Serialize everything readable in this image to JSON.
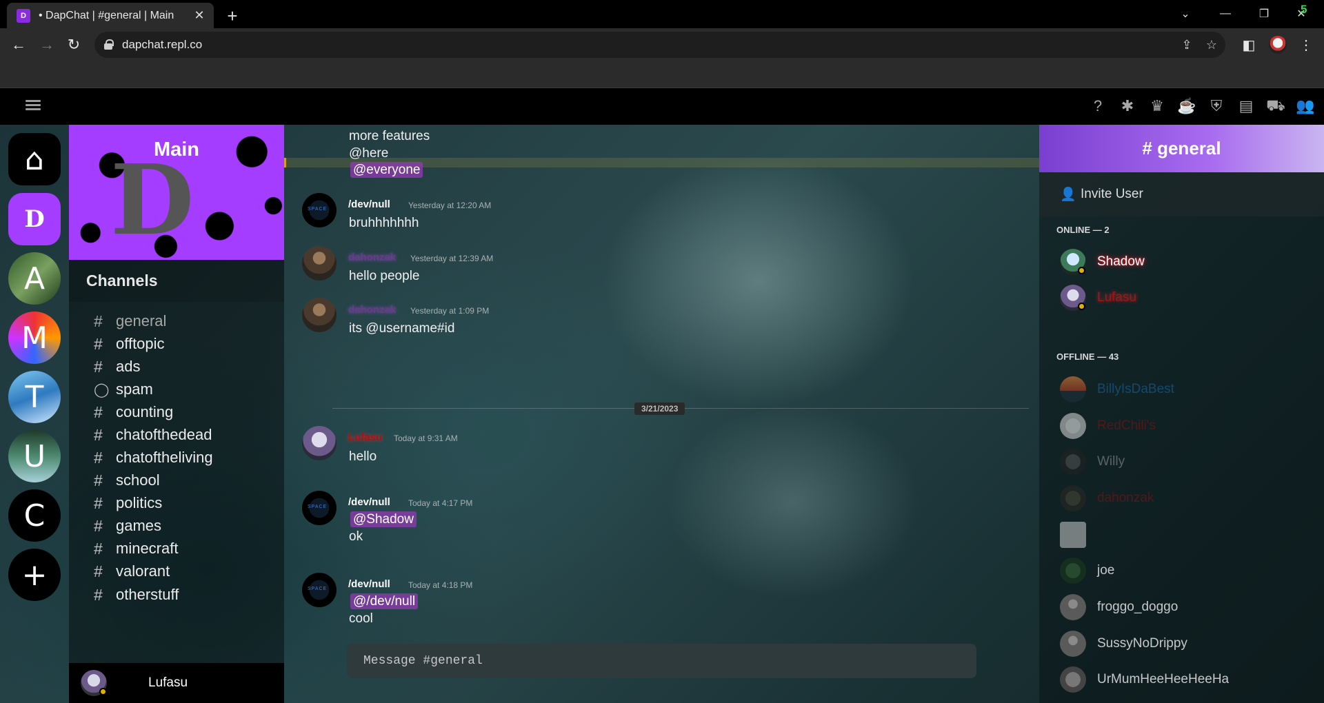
{
  "browser": {
    "tab_title": "• DapChat | #general | Main",
    "favicon": "D",
    "url": "dapchat.repl.co",
    "badge": "5"
  },
  "topnav": {
    "icons": [
      "help-icon",
      "bug-icon",
      "trophy-icon",
      "coffee-icon",
      "shield-icon",
      "briefcase-icon",
      "cart-icon",
      "friends-icon"
    ]
  },
  "servers": [
    {
      "label": "",
      "icon": "home-icon"
    },
    {
      "label": "",
      "icon": "dapchat-logo"
    },
    {
      "label": "A"
    },
    {
      "label": "M"
    },
    {
      "label": "T"
    },
    {
      "label": "U"
    },
    {
      "label": "C"
    },
    {
      "label": "+",
      "icon": "add-server-icon"
    }
  ],
  "server": {
    "banner_title": "Main",
    "banner_logo": "D"
  },
  "channels_header": "Channels",
  "channels": [
    {
      "name": "general",
      "type": "text",
      "active": true
    },
    {
      "name": "offtopic",
      "type": "text"
    },
    {
      "name": "ads",
      "type": "text"
    },
    {
      "name": "spam",
      "type": "chat"
    },
    {
      "name": "counting",
      "type": "text"
    },
    {
      "name": "chatofthedead",
      "type": "text"
    },
    {
      "name": "chatoftheliving",
      "type": "text"
    },
    {
      "name": "school",
      "type": "text"
    },
    {
      "name": "politics",
      "type": "text"
    },
    {
      "name": "games",
      "type": "text"
    },
    {
      "name": "minecraft",
      "type": "text"
    },
    {
      "name": "valorant",
      "type": "text"
    },
    {
      "name": "otherstuff",
      "type": "text"
    }
  ],
  "current_user": "Lufasu",
  "chat": {
    "partial_lines": [
      "more features",
      "@here"
    ],
    "everyone_mention": "@everyone",
    "messages": [
      {
        "author": "/dev/null",
        "time": "Yesterday at 12:20 AM",
        "lines": [
          "bruhhhhhhh"
        ]
      },
      {
        "author": "dahonzak",
        "time": "Yesterday at 12:39 AM",
        "lines": [
          "hello people"
        ]
      },
      {
        "author": "dahonzak",
        "time": "Yesterday at 1:09 PM",
        "lines": [
          "its @username#id"
        ]
      },
      {
        "author": "Lufasu",
        "time": "Today at 9:31 AM",
        "lines": [
          "hello"
        ]
      },
      {
        "author": "/dev/null",
        "time": "Today at 4:17 PM",
        "mention": "@Shadow",
        "lines": [
          "ok"
        ]
      },
      {
        "author": "/dev/null",
        "time": "Today at 4:18 PM",
        "mention": "@/dev/null",
        "lines": [
          "cool"
        ]
      }
    ],
    "date_divider": "3/21/2023",
    "composer_placeholder": "Message #general"
  },
  "members_panel": {
    "title": "# general",
    "invite_label": "Invite User",
    "online_header": "ONLINE — 2",
    "offline_header": "OFFLINE — 43",
    "online": [
      "Shadow",
      "Lufasu"
    ],
    "offline": [
      "BillyIsDaBest",
      "RedChili's",
      "Willy",
      "dahonzak",
      "",
      "joe",
      "froggo_doggo",
      "SussyNoDrippy",
      "UrMumHeeHeeHeeHa"
    ]
  },
  "colors": {
    "accent_purple": "#a43dff",
    "mention_bg": "#943ab4",
    "online_status": "#e0b000"
  }
}
